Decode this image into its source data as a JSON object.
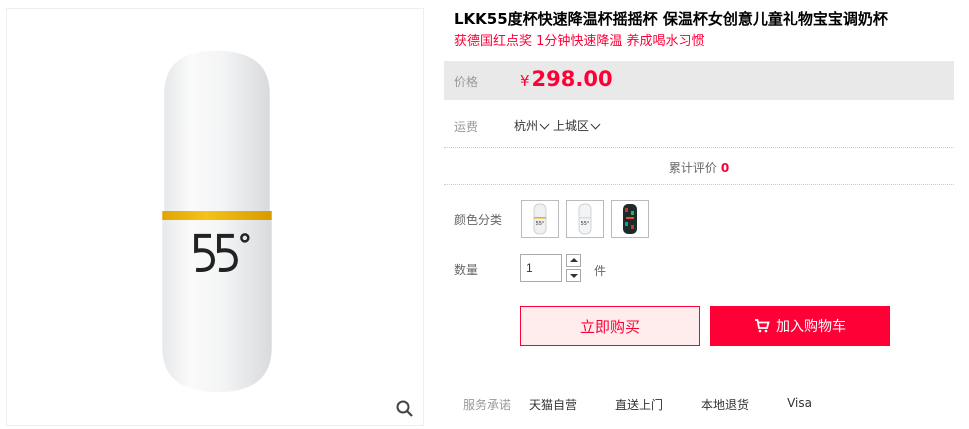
{
  "product": {
    "title": "LKK55度杯快速降温杯摇摇杯 保温杯女创意儿童礼物宝宝调奶杯",
    "subtitle": "获德国红点奖 1分钟快速降温 养成喝水习惯",
    "image_text": "55°"
  },
  "price": {
    "label": "价格",
    "currency": "¥",
    "value": "298.00"
  },
  "shipping": {
    "label": "运费",
    "city": "杭州",
    "district": "上城区"
  },
  "reviews": {
    "label": "累计评价",
    "count": "0"
  },
  "options": {
    "color_label": "颜色分类",
    "swatches": [
      "white-cup-1",
      "white-cup-2",
      "patterned-cup"
    ]
  },
  "quantity": {
    "label": "数量",
    "value": "1",
    "unit": "件"
  },
  "actions": {
    "buy_now": "立即购买",
    "add_to_cart": "加入购物车"
  },
  "service": {
    "label": "服务承诺",
    "items": [
      "天猫自营",
      "直送上门",
      "本地退货",
      "Visa"
    ]
  },
  "colors": {
    "accent": "#ff0036",
    "price_bg": "#e9e9e9",
    "cup_band": "#f0b300"
  }
}
